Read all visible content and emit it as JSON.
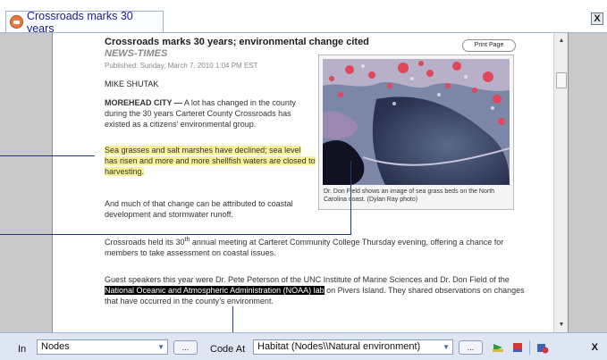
{
  "tab": {
    "title": "Crossroads marks 30 years",
    "close_label": "X"
  },
  "article": {
    "headline": "Crossroads marks 30 years; environmental change cited",
    "source": "NEWS-TIMES",
    "published": "Published: Sunday, March 7, 2010 1:04 PM EST",
    "author": "MIKE SHUTAK",
    "dateline": "MOREHEAD CITY —",
    "para1_rest": " A lot has changed in the county during the 30 years Carteret County Crossroads has existed as a citizens’ environmental group.",
    "highlight": "Sea grasses and salt marshes have declined; sea level has risen and more and more shellfish waters are closed to harvesting.",
    "para3": "And much of that change can be attributed to coastal development and stormwater runoff.",
    "para4_a": "Crossroads held its 30",
    "para4_sup": "th",
    "para4_b": " annual meeting at Carteret Community College Thursday evening, offering a chance for members to take assessment on coastal issues.",
    "para5_a": "Guest speakers this year were Dr. Pete Peterson of the UNC Institute of Marine Sciences and Dr. Don Field of the ",
    "para5_selected": "National Oceanic and Atmospheric Administration (NOAA) lab",
    "para5_b": " on Pivers Island. They shared observations on changes that have occurred in the county’s environment.",
    "print_label": "Print Page",
    "caption": "Dr. Don Field shows an image of sea grass beds on the North Carolina coast. (Dylan Ray photo)"
  },
  "toolbar": {
    "in_label": "In",
    "in_value": "Nodes",
    "dots_label": "...",
    "code_at_label": "Code At",
    "code_value": "Habitat (Nodes\\\\Natural environment)",
    "close_label": "X"
  }
}
